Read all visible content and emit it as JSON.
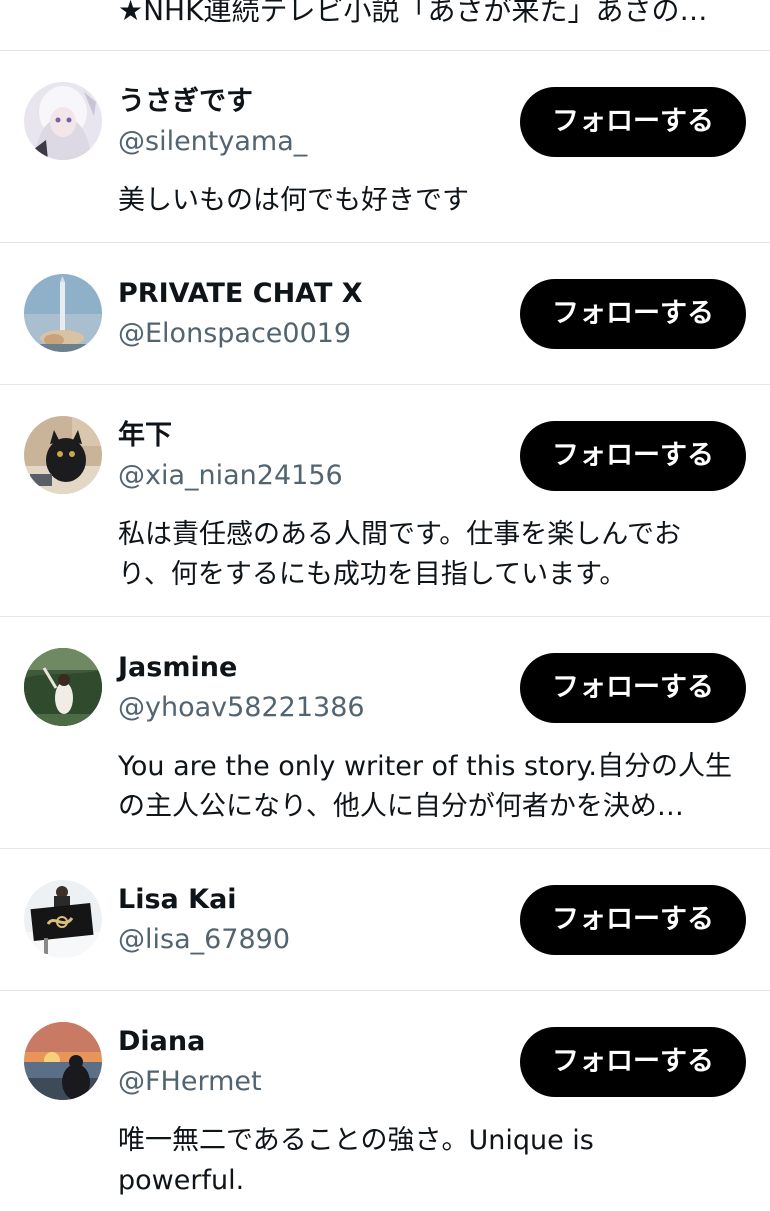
{
  "top_truncated_text": "★NHK連続テレビ小説「あさが来た」あさの…",
  "follow_label": "フォローする",
  "users": [
    {
      "display_name": "うさぎです",
      "handle": "@silentyama_",
      "bio_lines": [
        "美しいものは何でも好きです"
      ]
    },
    {
      "display_name": "PRIVATE CHAT X",
      "handle": "@Elonspace0019",
      "bio_lines": []
    },
    {
      "display_name": "年下",
      "handle": "@xia_nian24156",
      "bio_lines": [
        "私は責任感のある人間です。仕事を楽しんでお",
        "り、何をするにも成功を目指しています。"
      ]
    },
    {
      "display_name": "Jasmine",
      "handle": "@yhoav58221386",
      "bio_lines": [
        "You are the only writer of this story.自分の人生",
        "の主人公になり、他人に自分が何者かを決め…"
      ]
    },
    {
      "display_name": "Lisa Kai",
      "handle": "@lisa_67890",
      "bio_lines": []
    },
    {
      "display_name": "Diana",
      "handle": "@FHermet",
      "bio_lines": [
        "唯一無二であることの強さ。Unique is",
        "powerful."
      ]
    }
  ]
}
